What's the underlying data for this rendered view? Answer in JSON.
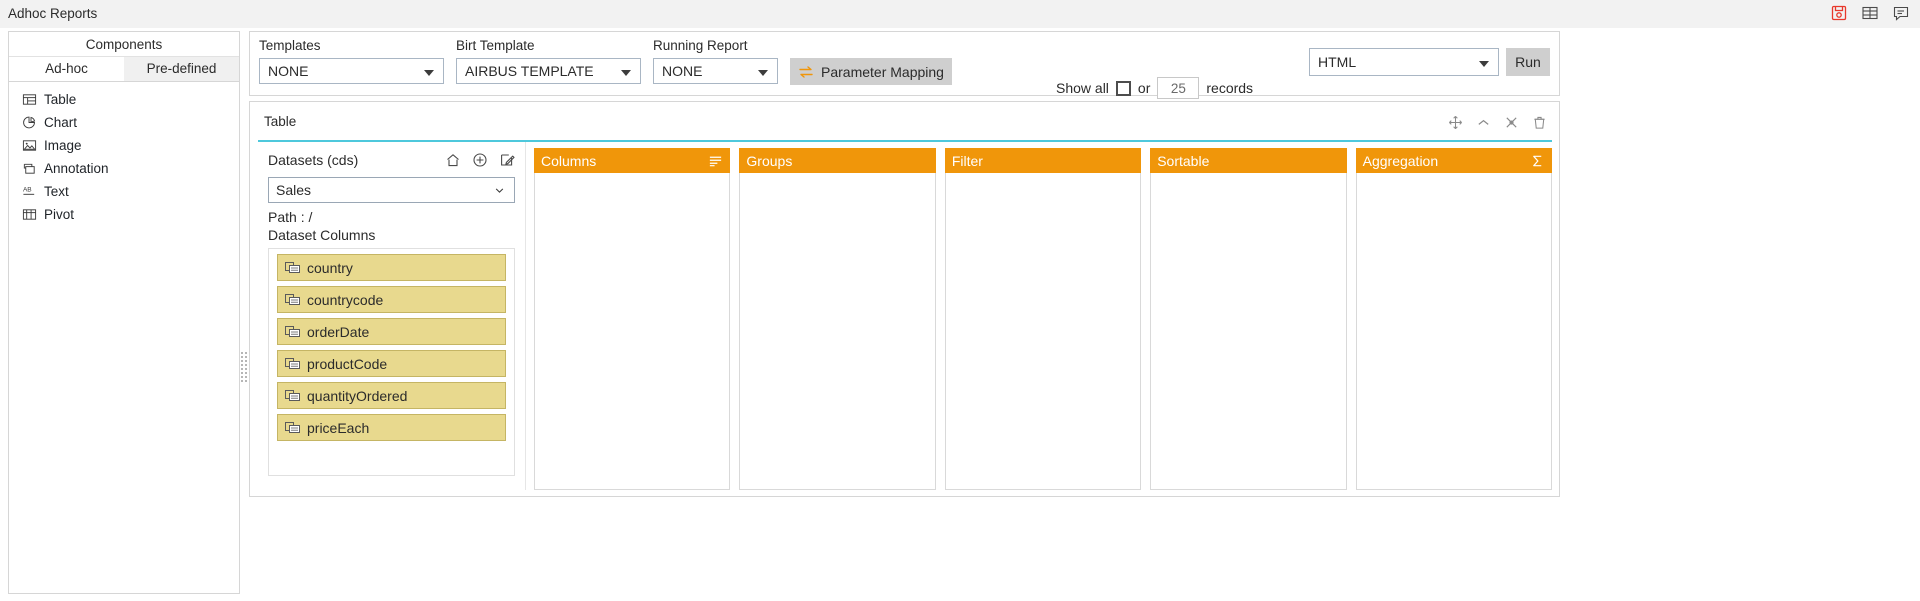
{
  "titlebar": {
    "title": "Adhoc Reports",
    "icons": [
      {
        "name": "save-icon",
        "label": "Save"
      },
      {
        "name": "table-grid-icon",
        "label": "Grid"
      },
      {
        "name": "comment-icon",
        "label": "Comment"
      }
    ]
  },
  "sidebar": {
    "header": "Components",
    "tabs": [
      {
        "label": "Ad-hoc",
        "active": true
      },
      {
        "label": "Pre-defined",
        "active": false
      }
    ],
    "items": [
      {
        "label": "Table",
        "icon": "table-icon"
      },
      {
        "label": "Chart",
        "icon": "pie-chart-icon"
      },
      {
        "label": "Image",
        "icon": "image-icon"
      },
      {
        "label": "Annotation",
        "icon": "annotation-icon"
      },
      {
        "label": "Text",
        "icon": "text-ab-icon"
      },
      {
        "label": "Pivot",
        "icon": "pivot-icon"
      }
    ]
  },
  "toolbar": {
    "templates_label": "Templates",
    "templates_value": "NONE",
    "birt_label": "Birt Template",
    "birt_value": "AIRBUS TEMPLATE",
    "running_label": "Running Report",
    "running_value": "NONE",
    "parameter_mapping_label": "Parameter Mapping",
    "show_all_label": "Show all",
    "or_label": "or",
    "records_value": "25",
    "records_label": "records",
    "format_value": "HTML",
    "run_label": "Run"
  },
  "content": {
    "title": "Table",
    "tools": [
      {
        "name": "move-icon"
      },
      {
        "name": "collapse-chevron-icon"
      },
      {
        "name": "settings-icon"
      },
      {
        "name": "delete-icon"
      }
    ],
    "datasets": {
      "label": "Datasets (cds)",
      "icons": [
        {
          "name": "home-icon"
        },
        {
          "name": "add-circle-icon"
        },
        {
          "name": "edit-icon"
        }
      ],
      "selected": "Sales",
      "path": "Path : /",
      "columns_label": "Dataset Columns",
      "columns": [
        "country",
        "countrycode",
        "orderDate",
        "productCode",
        "quantityOrdered",
        "priceEach"
      ]
    },
    "zones": [
      {
        "label": "Columns",
        "icon": "list-lines-icon"
      },
      {
        "label": "Groups",
        "icon": ""
      },
      {
        "label": "Filter",
        "icon": ""
      },
      {
        "label": "Sortable",
        "icon": ""
      },
      {
        "label": "Aggregation",
        "icon": "sigma-icon"
      }
    ]
  },
  "colors": {
    "zone_header": "#f0960a",
    "chip_bg": "#e8d98e",
    "panel_accent": "#4ec8dc",
    "save_icon": "#e8382b"
  }
}
